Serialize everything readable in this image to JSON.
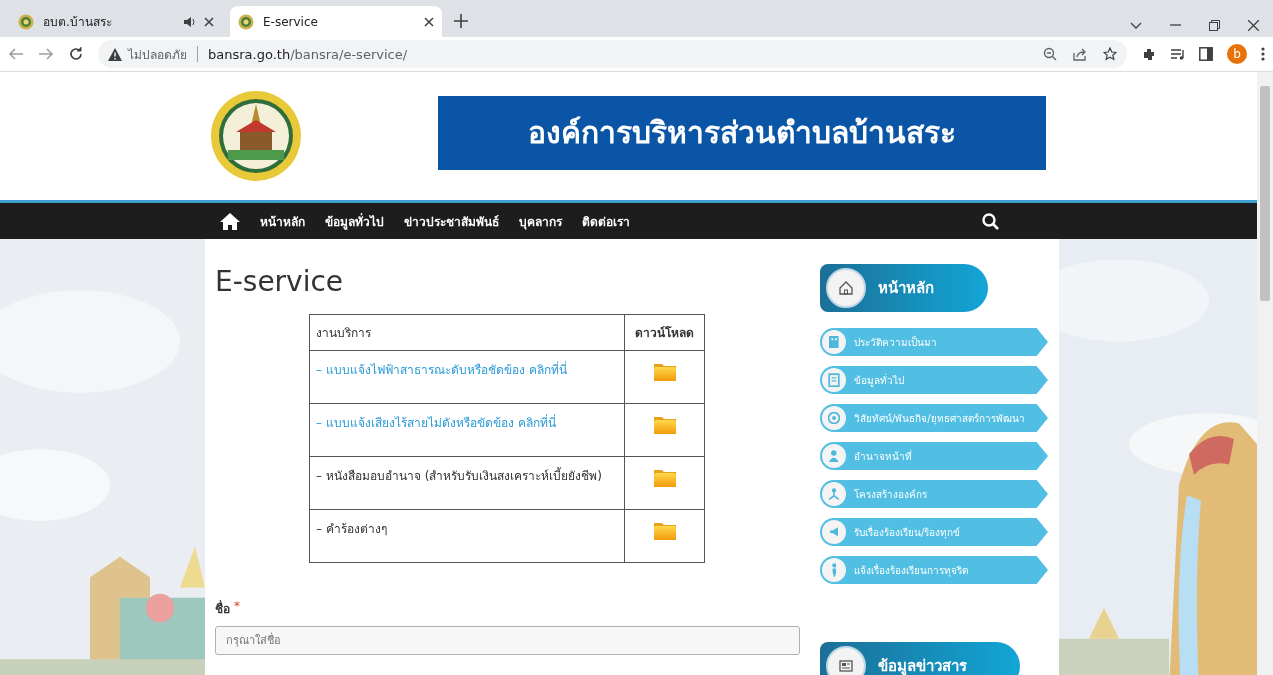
{
  "browser": {
    "tabs": [
      {
        "title": "อบต.บ้านสระ",
        "selected": false,
        "audio": true
      },
      {
        "title": "E-service",
        "selected": true,
        "audio": false
      }
    ],
    "security_label": "ไม่ปลอดภัย",
    "url_host": "bansra.go.th",
    "url_path": "/bansra/e-service/",
    "profile_initial": "b"
  },
  "header": {
    "banner_title": "องค์การบริหารส่วนตำบลบ้านสระ"
  },
  "nav": {
    "items": [
      "หน้าหลัก",
      "ข้อมูลทั่วไป",
      "ข่าวประชาสัมพันธ์",
      "บุคลากร",
      "ติดต่อเรา"
    ]
  },
  "page": {
    "title": "E-service",
    "table": {
      "columns": [
        "งานบริการ",
        "ดาวน์โหลด"
      ],
      "rows": [
        {
          "label": "– แบบแจ้งไฟฟ้าสาธารณะดับหรือชัดข้อง คลิกที่นี่",
          "kind": "link"
        },
        {
          "label": "– แบบแจ้งเสียงไร้สายไม่ดังหรือขัดข้อง คลิกที่นี่",
          "kind": "link"
        },
        {
          "label": "– หนังสือมอบอำนาจ (สำหรับรับเงินสงเคราะห์เบี้ยยังชีพ)",
          "kind": "text"
        },
        {
          "label": "– คำร้องต่างๆ",
          "kind": "text"
        }
      ]
    },
    "form": {
      "label": "ชื่อ",
      "required_mark": "*",
      "placeholder": "กรุณาใส่ชื่อ"
    }
  },
  "sidebar": {
    "home_title": "หน้าหลัก",
    "items": [
      "ประวัติความเป็นมา",
      "ข้อมูลทั่วไป",
      "วิสัยทัศน์/พันธกิจ/ยุทธศาสตร์การพัฒนา",
      "อำนาจหน้าที่",
      "โครงสร้างองค์กร",
      "รับเรื่องร้องเรียน/ร้องทุกข์",
      "แจ้งเรื่องร้องเรียนการทุจริต"
    ],
    "news_title": "ข้อมูลข่าวสาร"
  }
}
